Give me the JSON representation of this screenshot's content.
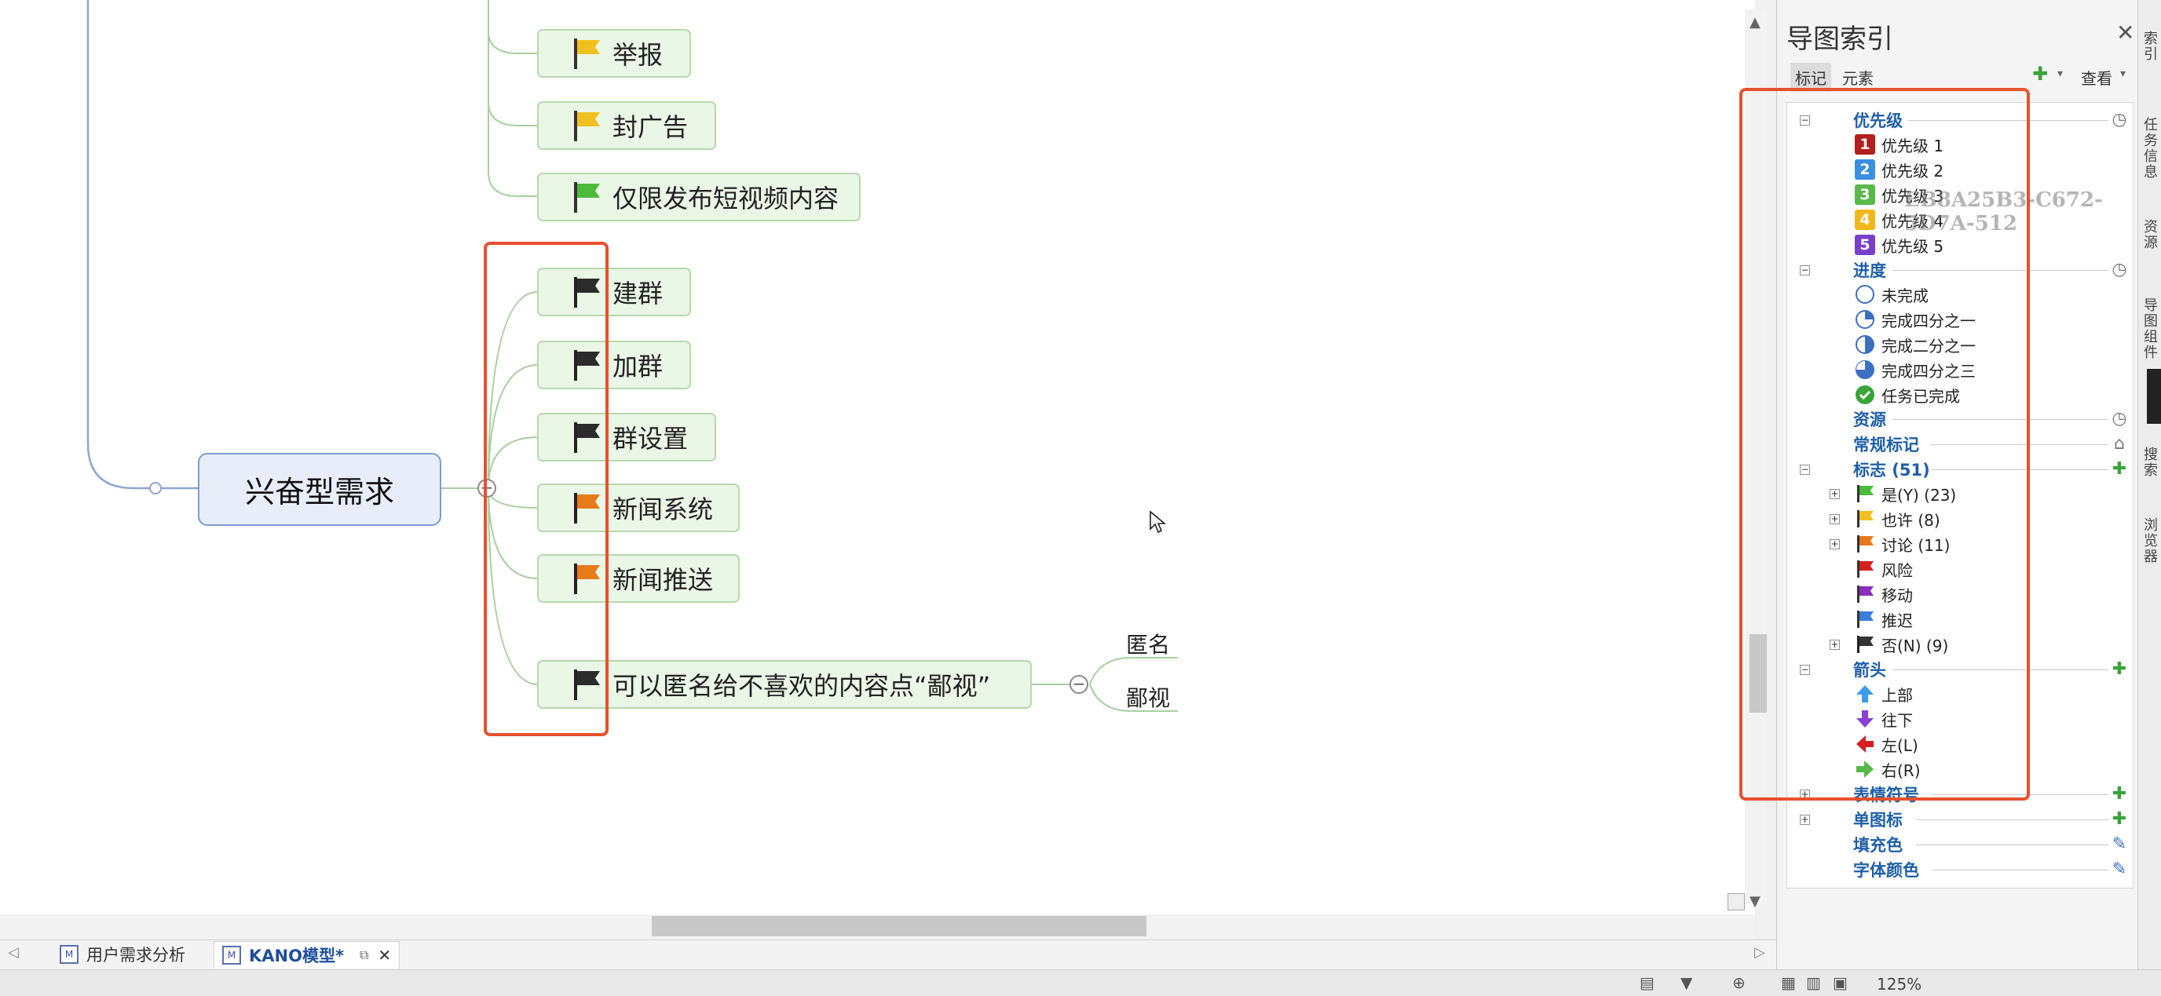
{
  "mindmap": {
    "central_topic": "兴奋型需求",
    "topics_upper": [
      "举报",
      "封广告",
      "仅限发布短视频内容"
    ],
    "topics": [
      "建群",
      "加群",
      "群设置",
      "新闻系统",
      "新闻推送",
      "可以匿名给不喜欢的内容点“鄙视”"
    ],
    "subtopics": [
      "匿名",
      "鄙视"
    ],
    "collapse_symbol": "−"
  },
  "tabs": {
    "tab1": "用户需求分析",
    "tab2": "KANO模型*",
    "close": "✕"
  },
  "panel": {
    "title": "导图索引",
    "close": "✕",
    "tab_markers": "标记",
    "tab_elements": "元素",
    "view_label": "查看",
    "categories": {
      "priority": "优先级",
      "progress": "进度",
      "resource": "资源",
      "general": "常规标记",
      "flags": "标志 (51)",
      "arrows": "箭头",
      "emoji": "表情符号",
      "single_icon": "单图标",
      "fill_color": "填充色",
      "font_color": "字体颜色"
    },
    "priorities": [
      {
        "num": "1",
        "label": "优先级 1",
        "color": "#b51e1e"
      },
      {
        "num": "2",
        "label": "优先级 2",
        "color": "#3a8fe0"
      },
      {
        "num": "3",
        "label": "优先级 3",
        "color": "#58b84a"
      },
      {
        "num": "4",
        "label": "优先级 4",
        "color": "#f0b81e"
      },
      {
        "num": "5",
        "label": "优先级 5",
        "color": "#7a3fc8"
      }
    ],
    "progress_items": [
      "未完成",
      "完成四分之一",
      "完成二分之一",
      "完成四分之三",
      "任务已完成"
    ],
    "flag_items": [
      {
        "label": "是(Y) (23)",
        "color": "#4cbb3c"
      },
      {
        "label": "也许 (8)",
        "color": "#f0c020"
      },
      {
        "label": "讨论 (11)",
        "color": "#e87a1a"
      },
      {
        "label": "风险",
        "color": "#d42020"
      },
      {
        "label": "移动",
        "color": "#8a2fc0"
      },
      {
        "label": "推迟",
        "color": "#3b7fd8"
      },
      {
        "label": "否(N) (9)",
        "color": "#333333"
      }
    ],
    "arrow_items": [
      "上部",
      "往下",
      "左(L)",
      "右(R)"
    ],
    "watermark": "EB8A25B3-C672-5D7A-512"
  },
  "side_strip": [
    "索引",
    "任务信息",
    "资源",
    "导图组件",
    "搜索",
    "浏览器"
  ],
  "status": {
    "zoom": "125%"
  },
  "colors": {
    "highlight": "#e8502e",
    "flag_black": "#2b2b2b",
    "flag_orange": "#e87a1a",
    "flag_yellow": "#f0c020",
    "flag_green": "#4cbb3c"
  }
}
